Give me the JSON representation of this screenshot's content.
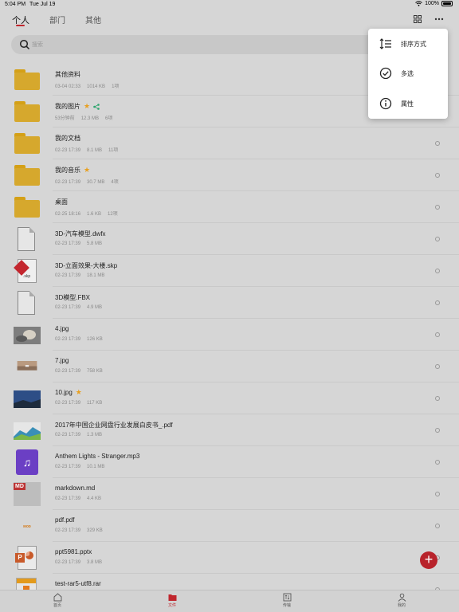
{
  "status_bar": {
    "time": "5:04 PM",
    "date": "Tue Jul 19",
    "battery": "100%"
  },
  "tabs": [
    {
      "label": "个人",
      "active": true
    },
    {
      "label": "部门",
      "active": false
    },
    {
      "label": "其他",
      "active": false
    }
  ],
  "search": {
    "placeholder": "搜索"
  },
  "files": [
    {
      "name": "其他资料",
      "date": "03-04 02:33",
      "size": "1014 KB",
      "count": "1项",
      "kind": "folder",
      "star": false,
      "share": false
    },
    {
      "name": "我的图片",
      "date": "53分钟前",
      "size": "12.3 MB",
      "count": "6项",
      "kind": "folder",
      "star": true,
      "share": true
    },
    {
      "name": "我的文档",
      "date": "02-23 17:39",
      "size": "8.1 MB",
      "count": "11项",
      "kind": "folder",
      "star": false,
      "share": false
    },
    {
      "name": "我的音乐",
      "date": "02-23 17:39",
      "size": "30.7 MB",
      "count": "4项",
      "kind": "folder",
      "star": true,
      "share": false
    },
    {
      "name": "桌面",
      "date": "02-25 18:16",
      "size": "1.6 KB",
      "count": "12项",
      "kind": "folder",
      "star": false,
      "share": false
    },
    {
      "name": "3D-汽车模型.dwfx",
      "date": "02-23 17:39",
      "size": "5.8 MB",
      "kind": "doc"
    },
    {
      "name": "3D-立面效果-大楼.skp",
      "date": "02-23 17:39",
      "size": "18.1 MB",
      "kind": "skp",
      "ext": ".skp"
    },
    {
      "name": "3D模型.FBX",
      "date": "02-23 17:39",
      "size": "4.9 MB",
      "kind": "doc"
    },
    {
      "name": "4.jpg",
      "date": "02-23 17:39",
      "size": "126 KB",
      "kind": "img1"
    },
    {
      "name": "7.jpg",
      "date": "02-23 17:39",
      "size": "758 KB",
      "kind": "img2"
    },
    {
      "name": "10.jpg",
      "date": "02-23 17:39",
      "size": "117 KB",
      "kind": "img3",
      "star": true
    },
    {
      "name": "2017年中国企业网盘行业发展白皮书_.pdf",
      "date": "02-23 17:39",
      "size": "1.3 MB",
      "kind": "img4"
    },
    {
      "name": "Anthem Lights - Stranger.mp3",
      "date": "02-23 17:39",
      "size": "10.1 MB",
      "kind": "mp3"
    },
    {
      "name": "markdown.md",
      "date": "02-23 17:39",
      "size": "4.4 KB",
      "kind": "md",
      "badge": "MD"
    },
    {
      "name": "pdf.pdf",
      "date": "02-23 17:39",
      "size": "329 KB",
      "kind": "pdfthumb",
      "thumb_text": "ᴍᴏᴅ"
    },
    {
      "name": "ppt5981.pptx",
      "date": "02-23 17:39",
      "size": "3.8 MB",
      "kind": "ppt",
      "badge": "P"
    },
    {
      "name": "test-rar5-utf8.rar",
      "date": "",
      "size": "",
      "kind": "rar"
    }
  ],
  "bottom_nav": [
    {
      "label": "首页",
      "icon": "home-icon",
      "active": false
    },
    {
      "label": "文件",
      "icon": "folder-icon",
      "active": true
    },
    {
      "label": "传输",
      "icon": "transfer-icon",
      "active": false
    },
    {
      "label": "我的",
      "icon": "profile-icon",
      "active": false
    }
  ],
  "menu": [
    {
      "label": "排序方式",
      "icon": "sort-icon"
    },
    {
      "label": "多选",
      "icon": "check-circle-icon"
    },
    {
      "label": "属性",
      "icon": "info-icon"
    }
  ],
  "fab": {
    "label": "+"
  },
  "colors": {
    "accent": "#c0262d",
    "folder": "#d6a82d",
    "star": "#e8a020",
    "share": "#2ca56c"
  }
}
